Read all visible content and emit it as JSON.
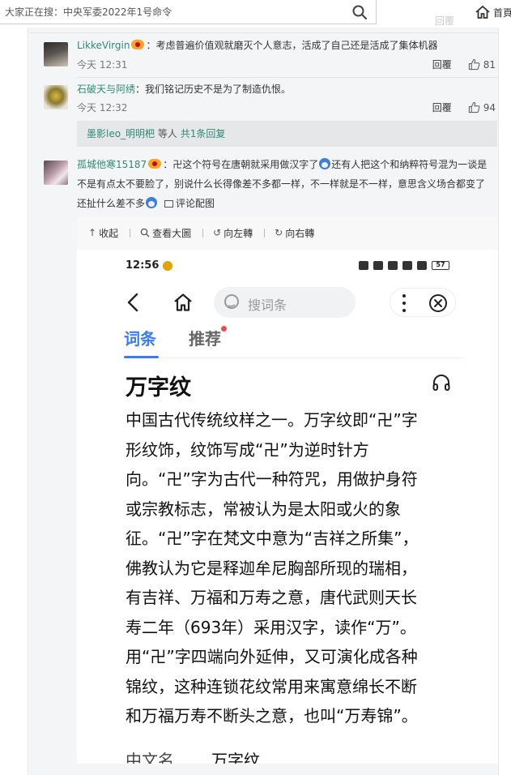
{
  "search": {
    "placeholder": "大家正在搜：中央军委2022年1号命令"
  },
  "header": {
    "home_label": "首頁",
    "ghost_reply": "回覆"
  },
  "comments": [
    {
      "user": "LikkeVirgin",
      "text": "：考虑普遍价值观就磨灭个人意志，活成了自己还是活成了集体机器",
      "time": "今天 12:31",
      "reply_label": "回覆",
      "likes": "81"
    },
    {
      "user": "石破天与阿绣",
      "text": "：我们铭记历史不是为了制造仇恨。",
      "time": "今天 12:32",
      "reply_label": "回覆",
      "likes": "94"
    }
  ],
  "reply_summary": {
    "users": "墨影leo_明明杷",
    "middle": " 等人 ",
    "count_text": "共1条回复"
  },
  "comment3": {
    "user": "孤城他寒15187",
    "text_a": "：卍这个符号在唐朝就采用做汉字了",
    "text_b": "还有人把这个和纳粹符号混为一谈是不是有点太不要脸了，别说什么长得像差不多都一样，不一样就是不一样，意思含义场合都变了还扯什么差不多",
    "pic_link": "评论配图"
  },
  "image_toolbar": {
    "collapse": "收起",
    "view_large": "查看大圖",
    "rotate_left": "向左轉",
    "rotate_right": "向右轉"
  },
  "phone": {
    "clock": "12:56",
    "battery": "57",
    "search_placeholder": "搜词条",
    "tabs": [
      "词条",
      "推荐"
    ],
    "title": "万字纹",
    "lines": [
      "中国古代传统纹样之一。万字纹即“卍”字",
      "形纹饰，纹饰写成“卍”为逆时针方",
      "向。“卍”字为古代一种符咒，用做护身符",
      "或宗教标志，常被认为是太阳或火的象",
      "征。“卍”字在梵文中意为“吉祥之所集”，",
      "佛教认为它是释迦牟尼胸部所现的瑞相，",
      "有吉祥、万福和万寿之意，唐代武则天长",
      "寿二年（693年）采用汉字，读作“万”。",
      "用“卍”字四端向外延伸，又可演化成各种",
      "锦纹，这种连锁花纹常用来寓意绵长不断",
      "和万福万寿不断头之意，也叫“万寿锦”。"
    ],
    "prop_key": "中文名",
    "prop_value": "万字纹"
  },
  "colors": {
    "username": "#2f8a78",
    "accent_blue": "#3a7df2",
    "badge_red": "#f04a4a"
  }
}
